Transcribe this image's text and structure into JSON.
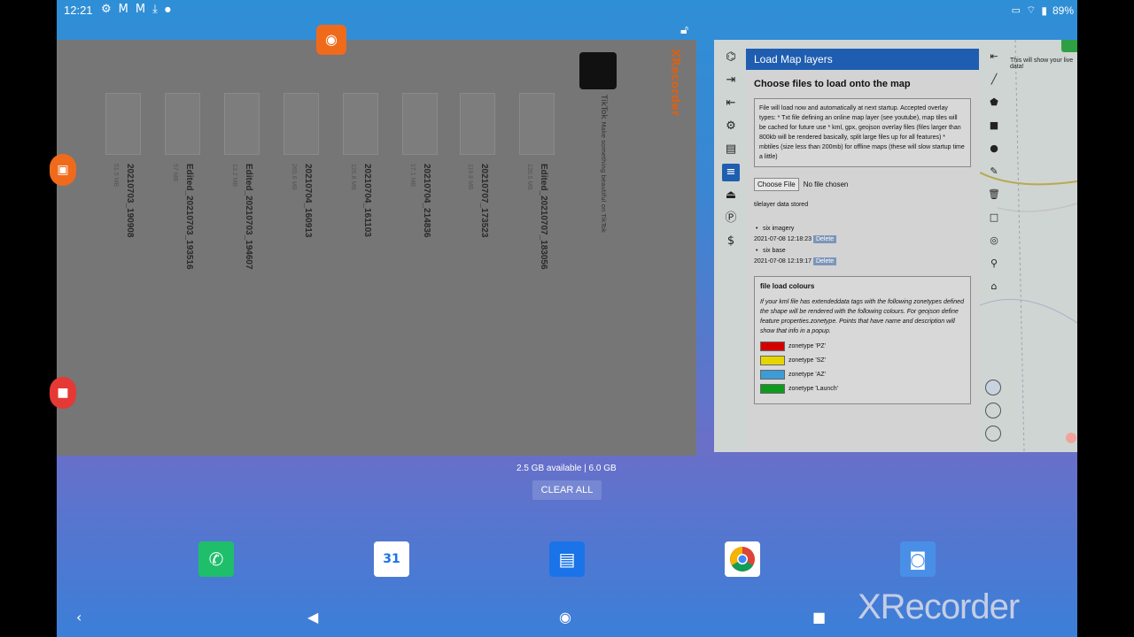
{
  "status_bar": {
    "time": "12:21",
    "left_icons": [
      "gear-icon",
      "gmail-icon",
      "gmail-icon",
      "download-icon",
      "dot-icon"
    ],
    "battery": "89%"
  },
  "recents": {
    "left_card": {
      "app_name": "XRecorder",
      "recordings": [
        {
          "name": "20210703_190908",
          "meta": "51.5 MB"
        },
        {
          "name": "Edited_20210703_193516",
          "meta": "57 MB"
        },
        {
          "name": "Edited_20210703_194607",
          "meta": "13.2 MB"
        },
        {
          "name": "20210704_160913",
          "meta": "265.6 MB"
        },
        {
          "name": "20210704_161103",
          "meta": "126.8 MB"
        },
        {
          "name": "20210704_214836",
          "meta": "17.1 MB"
        },
        {
          "name": "20210707_173523",
          "meta": "119.8 MB"
        },
        {
          "name": "Edited_20210707_183056",
          "meta": "120.5 MB"
        }
      ],
      "tiktok_label": "TikTok",
      "tiktok_sub": "Make something beautiful on TikTok"
    },
    "right_card": {
      "dialog_title": "Load Map layers",
      "heading": "Choose files to load onto the map",
      "info": "File will load now and automatically at next startup. Accepted overlay types: * Txt file defining an online map layer (see youtube), map tiles will be cached for future use * kml, gpx, geojson overlay files (files larger than 800kb will be rendered basically, split large files up for all features) * mbtiles (size less than 200mb) for offline maps (these will slow startup time a little)",
      "choose_file_label": "Choose File",
      "no_file_label": "No file chosen",
      "tilelayer_label": "tilelayer data stored",
      "tiles": [
        {
          "name": "six imagery",
          "date": "2021-07-08 12:18:23",
          "delete": "Delete"
        },
        {
          "name": "six base",
          "date": "2021-07-08 12:19:17",
          "delete": "Delete"
        }
      ],
      "colours_title": "file load colours",
      "colours_desc": "If your kml file has extendeddata tags with the following zonetypes defined the shape will be rendered with the following colours. For geojson define feature properties.zonetype. Points that have name and description will show that info in a popup.",
      "zones": [
        {
          "label": "zonetype 'PZ'",
          "color": "#d40000"
        },
        {
          "label": "zonetype 'SZ'",
          "color": "#e5d600"
        },
        {
          "label": "zonetype 'AZ'",
          "color": "#3d9bd6"
        },
        {
          "label": "zonetype 'Launch'",
          "color": "#0e9a1c"
        }
      ],
      "tip": "This will show your live data!"
    },
    "memory": "2.5 GB available | 6.0 GB",
    "clear_all": "CLEAR ALL"
  },
  "dock": [
    "phone-icon",
    "calendar-icon",
    "messages-icon",
    "chrome-icon",
    "camera-icon"
  ],
  "watermark": "XRecorder"
}
